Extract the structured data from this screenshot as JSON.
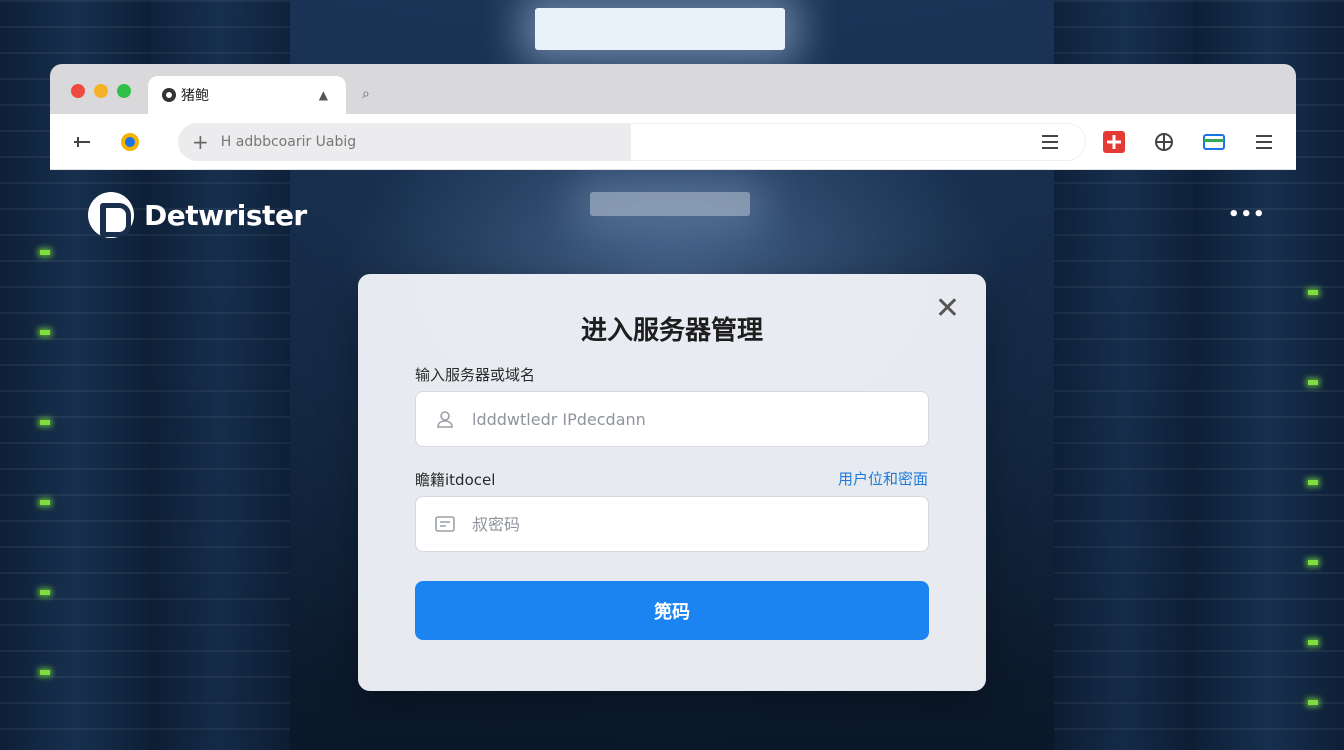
{
  "browser": {
    "tab_title": "猪鲍",
    "tab_close": "▲",
    "new_tab": "⌕",
    "address_text": "H adbbcoarir Uabig",
    "icons": {
      "back": "back-icon",
      "site": "site-icon",
      "menu": "menu-icon",
      "ext_red": "red-extension-icon",
      "ext_globe": "globe-icon",
      "ext_wallet": "wallet-icon",
      "hamburger": "hamburger-icon"
    }
  },
  "page": {
    "logo_text": "Detwrister",
    "more_menu": "•••"
  },
  "modal": {
    "title": "进入服务器管理",
    "close_symbol": "✕",
    "host_label": "输入服务器或域名",
    "host_placeholder": "ldddwtledr IPdecdann",
    "host_value": "",
    "password_label": "瞻籍itdocel",
    "password_link": "用户位和密面",
    "password_placeholder": "叔密码",
    "password_value": "",
    "submit_label": "篼码"
  },
  "colors": {
    "accent": "#1b84f0",
    "link": "#1e7bd8",
    "traffic_red": "#ef4a3f",
    "traffic_yellow": "#f6b226",
    "traffic_green": "#2fbf47",
    "led_green": "#7dde3e"
  }
}
